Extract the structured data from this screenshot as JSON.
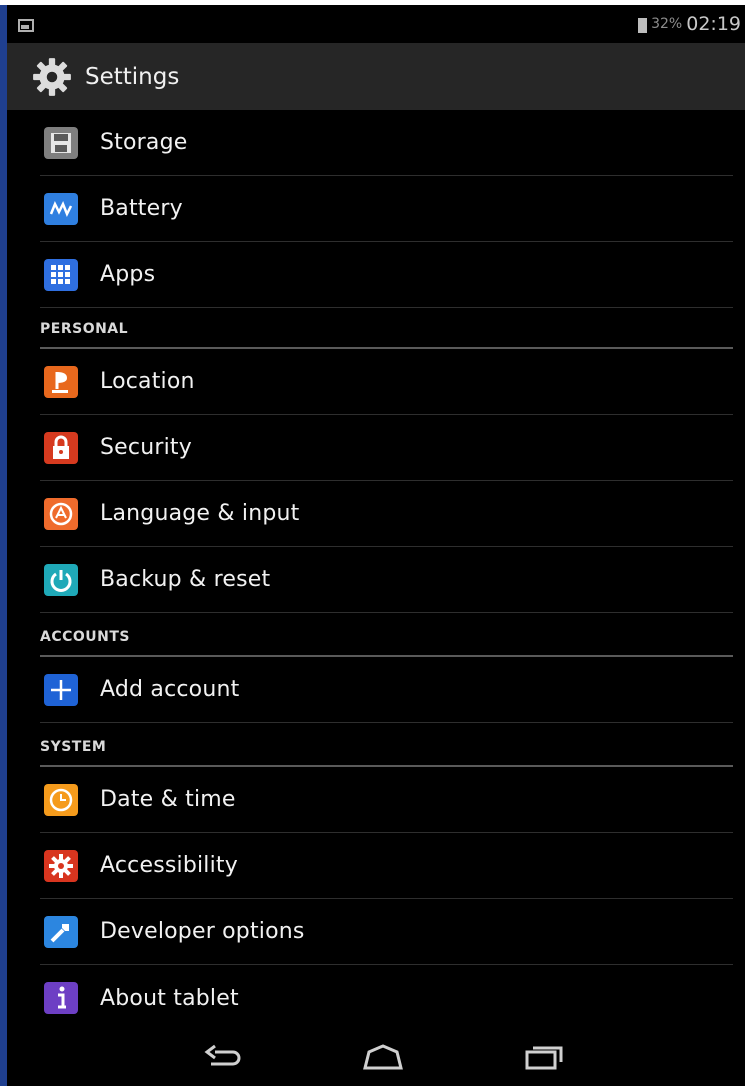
{
  "status_bar": {
    "battery_text": "32%",
    "time": "02:19"
  },
  "action_bar": {
    "title": "Settings",
    "icon": "gear-icon"
  },
  "items_top": [
    {
      "label": "Storage",
      "icon": "storage-icon",
      "color": "#7f7f7f"
    },
    {
      "label": "Battery",
      "icon": "battery-icon",
      "color": "#2f7fe0"
    },
    {
      "label": "Apps",
      "icon": "apps-icon",
      "color": "#2f6fe0"
    }
  ],
  "sections": {
    "personal": "PERSONAL",
    "accounts": "ACCOUNTS",
    "system": "SYSTEM"
  },
  "items_personal": [
    {
      "label": "Location",
      "icon": "location-icon",
      "color": "#e8681d"
    },
    {
      "label": "Security",
      "icon": "lock-icon",
      "color": "#d63a1f"
    },
    {
      "label": "Language & input",
      "icon": "language-icon",
      "color": "#ef6b2c"
    },
    {
      "label": "Backup & reset",
      "icon": "backup-icon",
      "color": "#1fa9b8"
    }
  ],
  "items_accounts": [
    {
      "label": "Add account",
      "icon": "add-icon",
      "color": "#1f63d6"
    }
  ],
  "items_system": [
    {
      "label": "Date & time",
      "icon": "clock-icon",
      "color": "#f59b1c"
    },
    {
      "label": "Accessibility",
      "icon": "accessibility-icon",
      "color": "#d8351f"
    },
    {
      "label": "Developer options",
      "icon": "developer-icon",
      "color": "#2c86e0"
    },
    {
      "label": "About tablet",
      "icon": "info-icon",
      "color": "#6d3fc4"
    }
  ]
}
